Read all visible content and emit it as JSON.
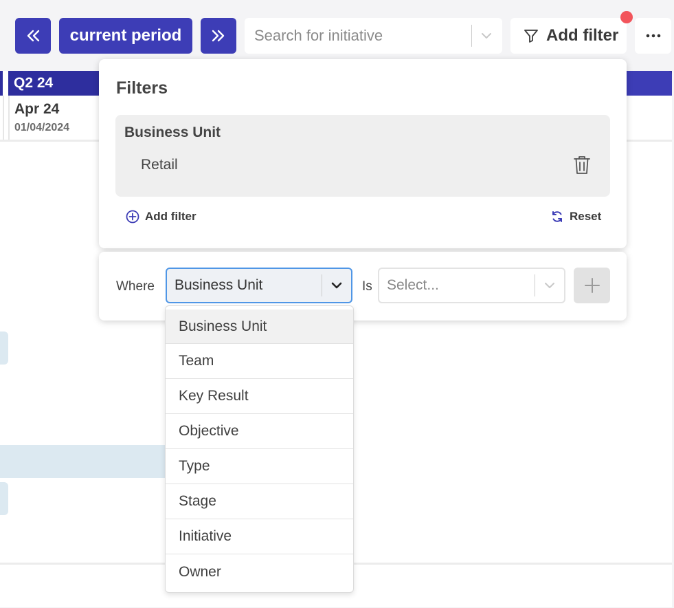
{
  "toolbar": {
    "prev_icon": "double-chevron-left-icon",
    "period_label": "current period",
    "next_icon": "double-chevron-right-icon",
    "search_placeholder": "Search for initiative",
    "add_filter_label": "Add filter",
    "more_icon": "ellipsis-icon",
    "accent_color": "#3d3db6",
    "notification_color": "#f2545b"
  },
  "timeline": {
    "quarter": "Q2 24",
    "month": "Apr 24",
    "month_date": "01/04/2024"
  },
  "filters_panel": {
    "title": "Filters",
    "active_filters": [
      {
        "field": "Business Unit",
        "value": "Retail"
      }
    ],
    "add_filter_label": "Add filter",
    "reset_label": "Reset"
  },
  "where_row": {
    "where_label": "Where",
    "field_value": "Business Unit",
    "is_label": "Is",
    "value_placeholder": "Select..."
  },
  "field_options": [
    "Business Unit",
    "Team",
    "Key Result",
    "Objective",
    "Type",
    "Stage",
    "Initiative",
    "Owner"
  ]
}
